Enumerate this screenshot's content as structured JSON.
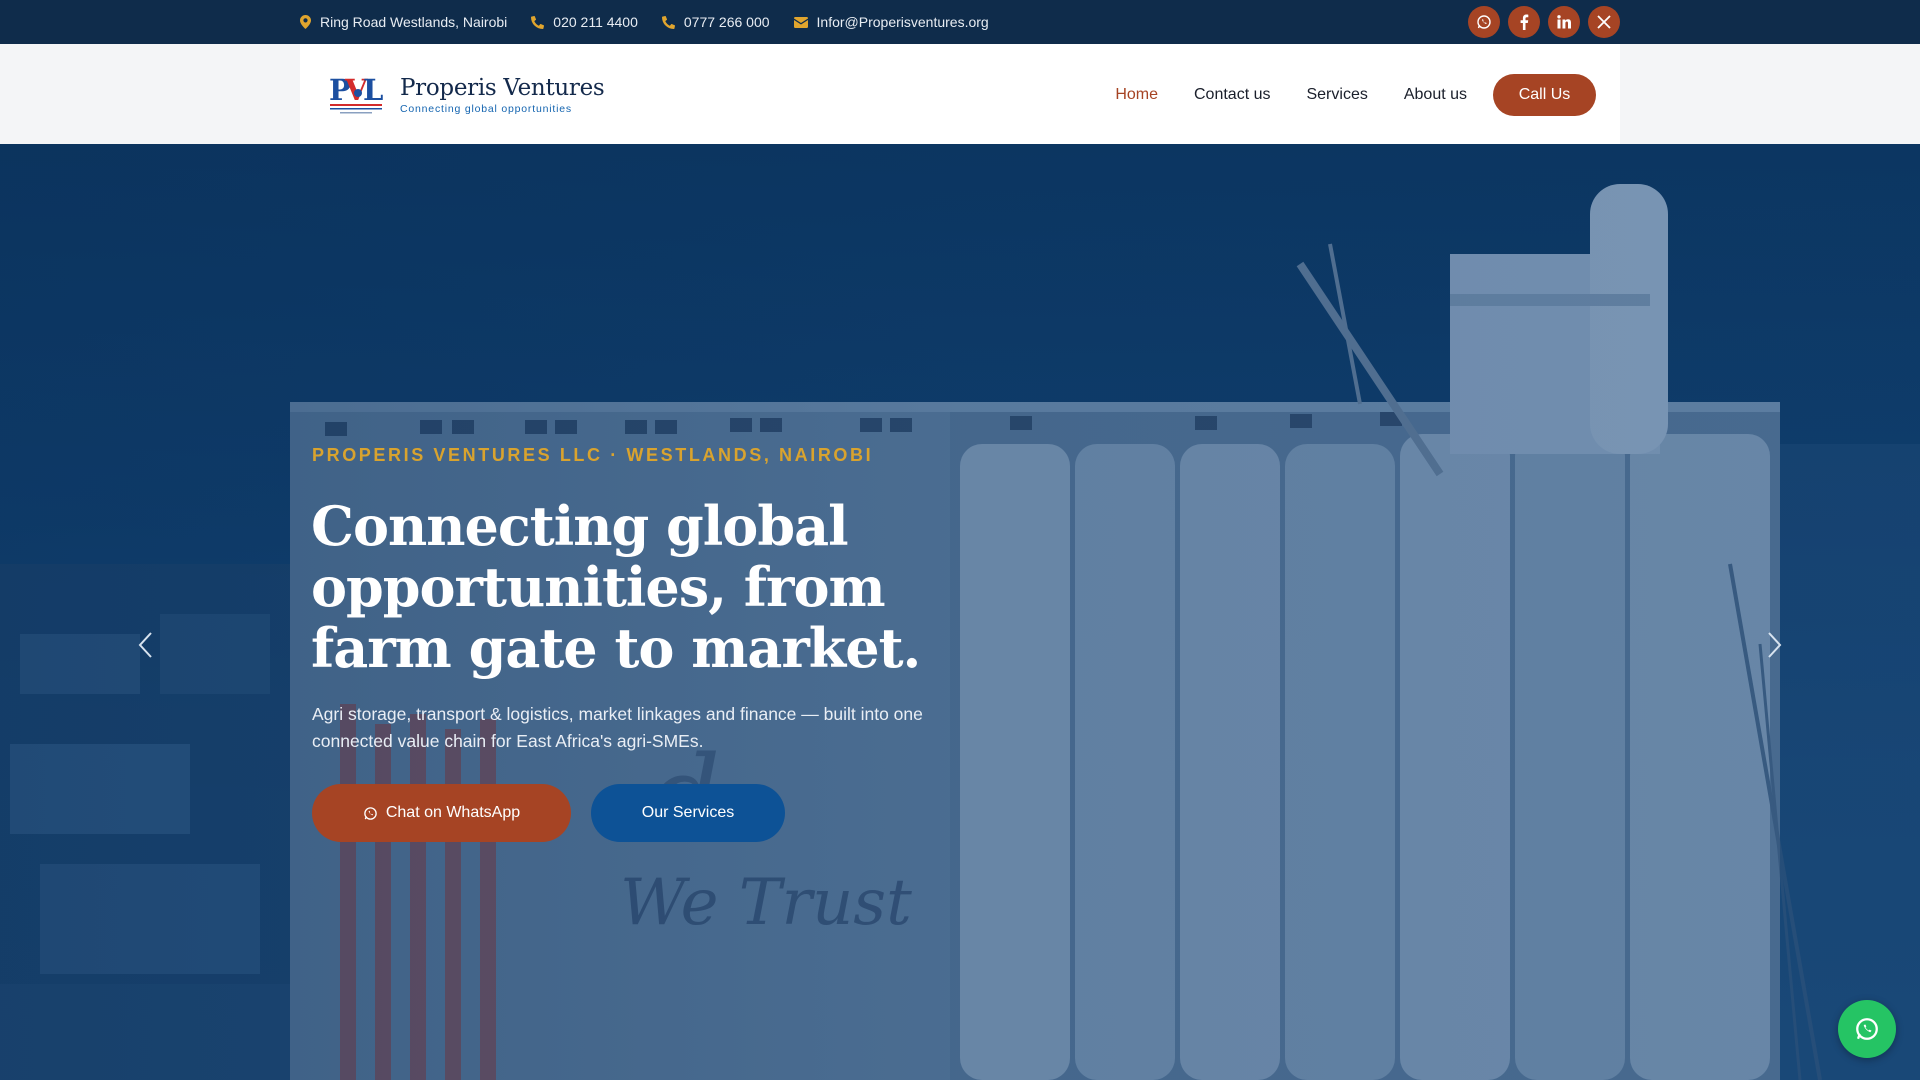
{
  "topbar": {
    "address": "Ring Road Westlands, Nairobi",
    "phone1": "020 211 4400",
    "phone2": "0777 266 000",
    "email": "Infor@Properisventures.org",
    "socials": [
      "whatsapp-icon",
      "facebook-icon",
      "linkedin-icon",
      "x-icon"
    ]
  },
  "header": {
    "logo_mark": "PVL",
    "logo_name": "Properis Ventures",
    "logo_tagline": "Connecting global opportunities",
    "nav": [
      "Home",
      "Contact us",
      "Services",
      "About us"
    ],
    "active_nav": "Home",
    "cta_label": "Call Us"
  },
  "hero": {
    "eyebrow": "PROPERIS VENTURES LLC · WESTLANDS, NAIROBI",
    "headline": "Connecting global opportunities, from farm gate to market.",
    "subtext": "Agri storage, transport & logistics, market linkages and finance — built into one connected value chain for East Africa's agri-SMEs.",
    "btn_whatsapp": "Chat on WhatsApp",
    "btn_services": "Our Services"
  },
  "colors": {
    "topbar_bg": "#0f2c4b",
    "accent": "#a64424",
    "gold": "#d9a32e",
    "blue_button": "#0d5296",
    "whatsapp_green": "#25c464"
  }
}
